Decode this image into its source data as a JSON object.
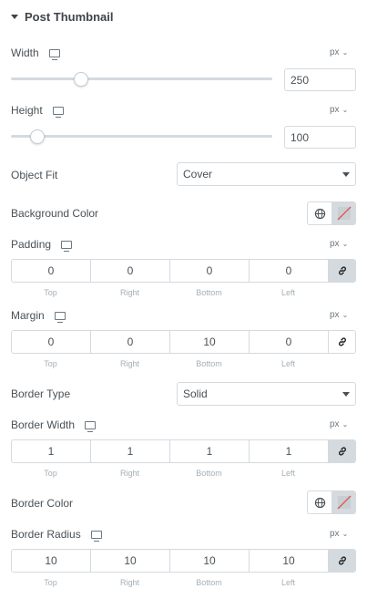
{
  "section": {
    "title": "Post Thumbnail"
  },
  "width": {
    "label": "Width",
    "unit": "px",
    "value": "250",
    "slider_fraction": 0.27
  },
  "height": {
    "label": "Height",
    "unit": "px",
    "value": "100",
    "slider_fraction": 0.1
  },
  "object_fit": {
    "label": "Object Fit",
    "value": "Cover"
  },
  "background_color": {
    "label": "Background Color"
  },
  "padding": {
    "label": "Padding",
    "unit": "px",
    "values": [
      "0",
      "0",
      "0",
      "0"
    ]
  },
  "margin": {
    "label": "Margin",
    "unit": "px",
    "values": [
      "0",
      "0",
      "10",
      "0"
    ]
  },
  "border_type": {
    "label": "Border Type",
    "value": "Solid"
  },
  "border_width": {
    "label": "Border Width",
    "unit": "px",
    "values": [
      "1",
      "1",
      "1",
      "1"
    ]
  },
  "border_color": {
    "label": "Border Color"
  },
  "border_radius": {
    "label": "Border Radius",
    "unit": "px",
    "values": [
      "10",
      "10",
      "10",
      "10"
    ]
  },
  "sides": [
    "Top",
    "Right",
    "Bottom",
    "Left"
  ],
  "icons": {
    "responsive": "monitor-icon",
    "link": "link-icon",
    "globe": "globe-icon",
    "clear": "slashed-swatch-icon",
    "caret": "caret-down-icon"
  }
}
